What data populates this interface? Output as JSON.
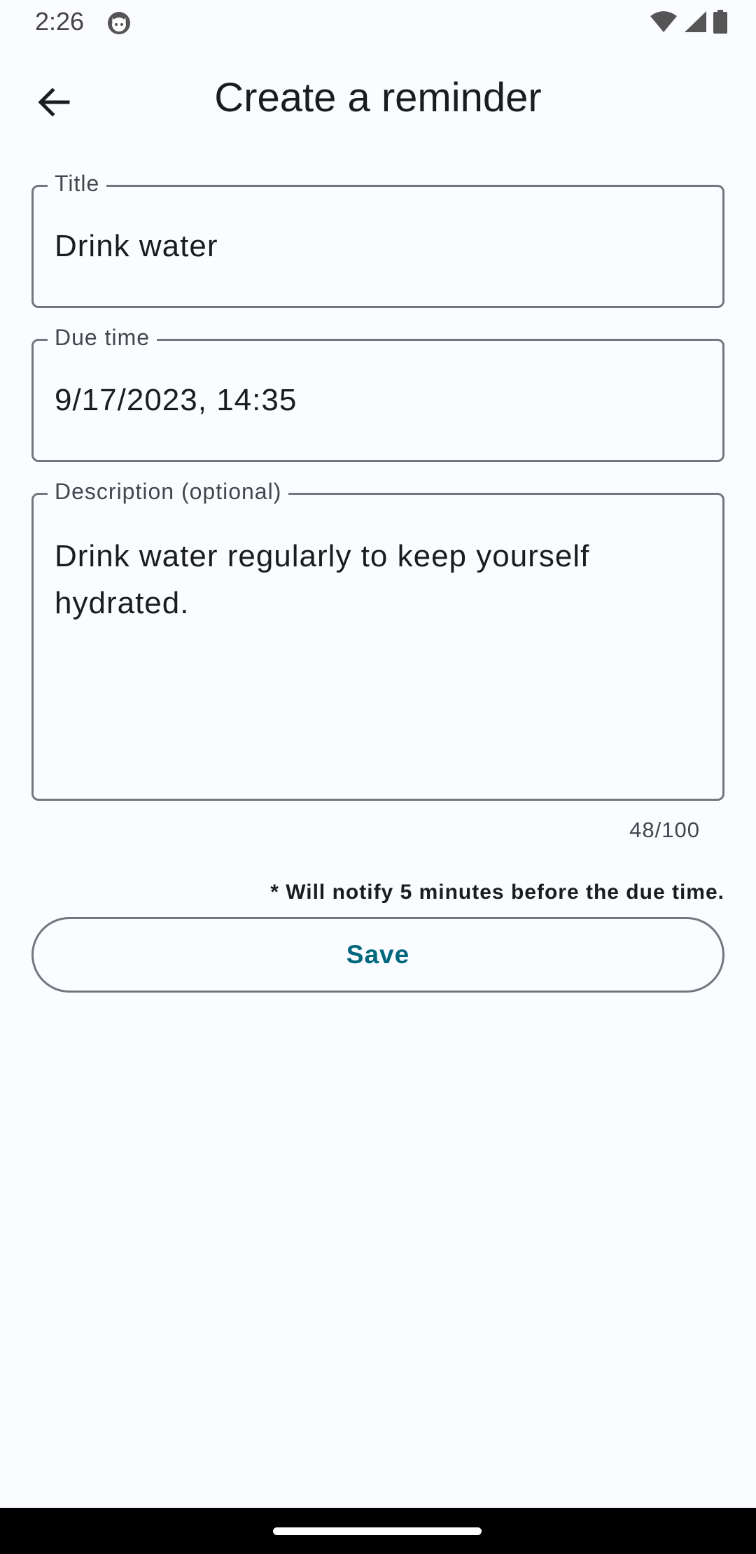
{
  "status_bar": {
    "time": "2:26",
    "notification_icon": "cat-face-icon",
    "icons": [
      "wifi-icon",
      "signal-icon",
      "battery-icon"
    ]
  },
  "app_bar": {
    "back_icon": "arrow-back-icon",
    "title": "Create a reminder"
  },
  "form": {
    "title_field": {
      "label": "Title",
      "value": "Drink water"
    },
    "due_field": {
      "label": "Due time",
      "value": "9/17/2023, 14:35"
    },
    "description_field": {
      "label": "Description (optional)",
      "value": "Drink water regularly to keep yourself hydrated.",
      "line1": "Drink water regularly to keep yourself",
      "line2": "hydrated.",
      "counter": "48/100"
    },
    "note": "* Will notify 5 minutes before the due time.",
    "save_label": "Save"
  },
  "colors": {
    "background": "#fbfcff",
    "accent": "#00677e",
    "outline": "#72777f"
  }
}
